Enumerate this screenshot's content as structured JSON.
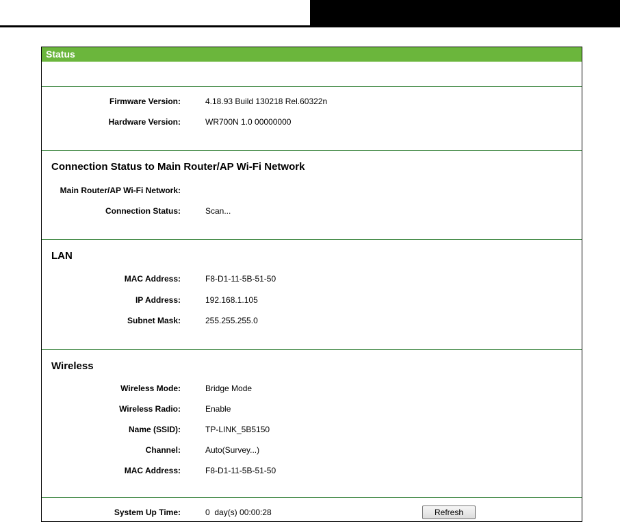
{
  "panel": {
    "title": "Status"
  },
  "firmware": {
    "rows": [
      {
        "label": "Firmware Version:",
        "value": "4.18.93 Build 130218 Rel.60322n"
      },
      {
        "label": "Hardware Version:",
        "value": "WR700N 1.0 00000000"
      }
    ]
  },
  "connection": {
    "title": "Connection Status to Main Router/AP Wi-Fi Network",
    "rows": [
      {
        "label": "Main Router/AP Wi-Fi Network:",
        "value": ""
      },
      {
        "label": "Connection Status:",
        "value": "Scan..."
      }
    ]
  },
  "lan": {
    "title": "LAN",
    "rows": [
      {
        "label": "MAC Address:",
        "value": "F8-D1-11-5B-51-50"
      },
      {
        "label": "IP Address:",
        "value": "192.168.1.105"
      },
      {
        "label": "Subnet Mask:",
        "value": "255.255.255.0"
      }
    ]
  },
  "wireless": {
    "title": "Wireless",
    "rows": [
      {
        "label": "Wireless Mode:",
        "value": "Bridge Mode"
      },
      {
        "label": "Wireless Radio:",
        "value": "Enable"
      },
      {
        "label": "Name (SSID):",
        "value": "TP-LINK_5B5150"
      },
      {
        "label": "Channel:",
        "value": "Auto(Survey...)"
      },
      {
        "label": "MAC Address:",
        "value": "F8-D1-11-5B-51-50"
      }
    ]
  },
  "footer": {
    "uptime_label": "System Up Time:",
    "uptime_value": "0  day(s) 00:00:28",
    "refresh_label": "Refresh"
  },
  "colors": {
    "header_green": "#6bb63c",
    "separator_green": "#2e7d32"
  }
}
